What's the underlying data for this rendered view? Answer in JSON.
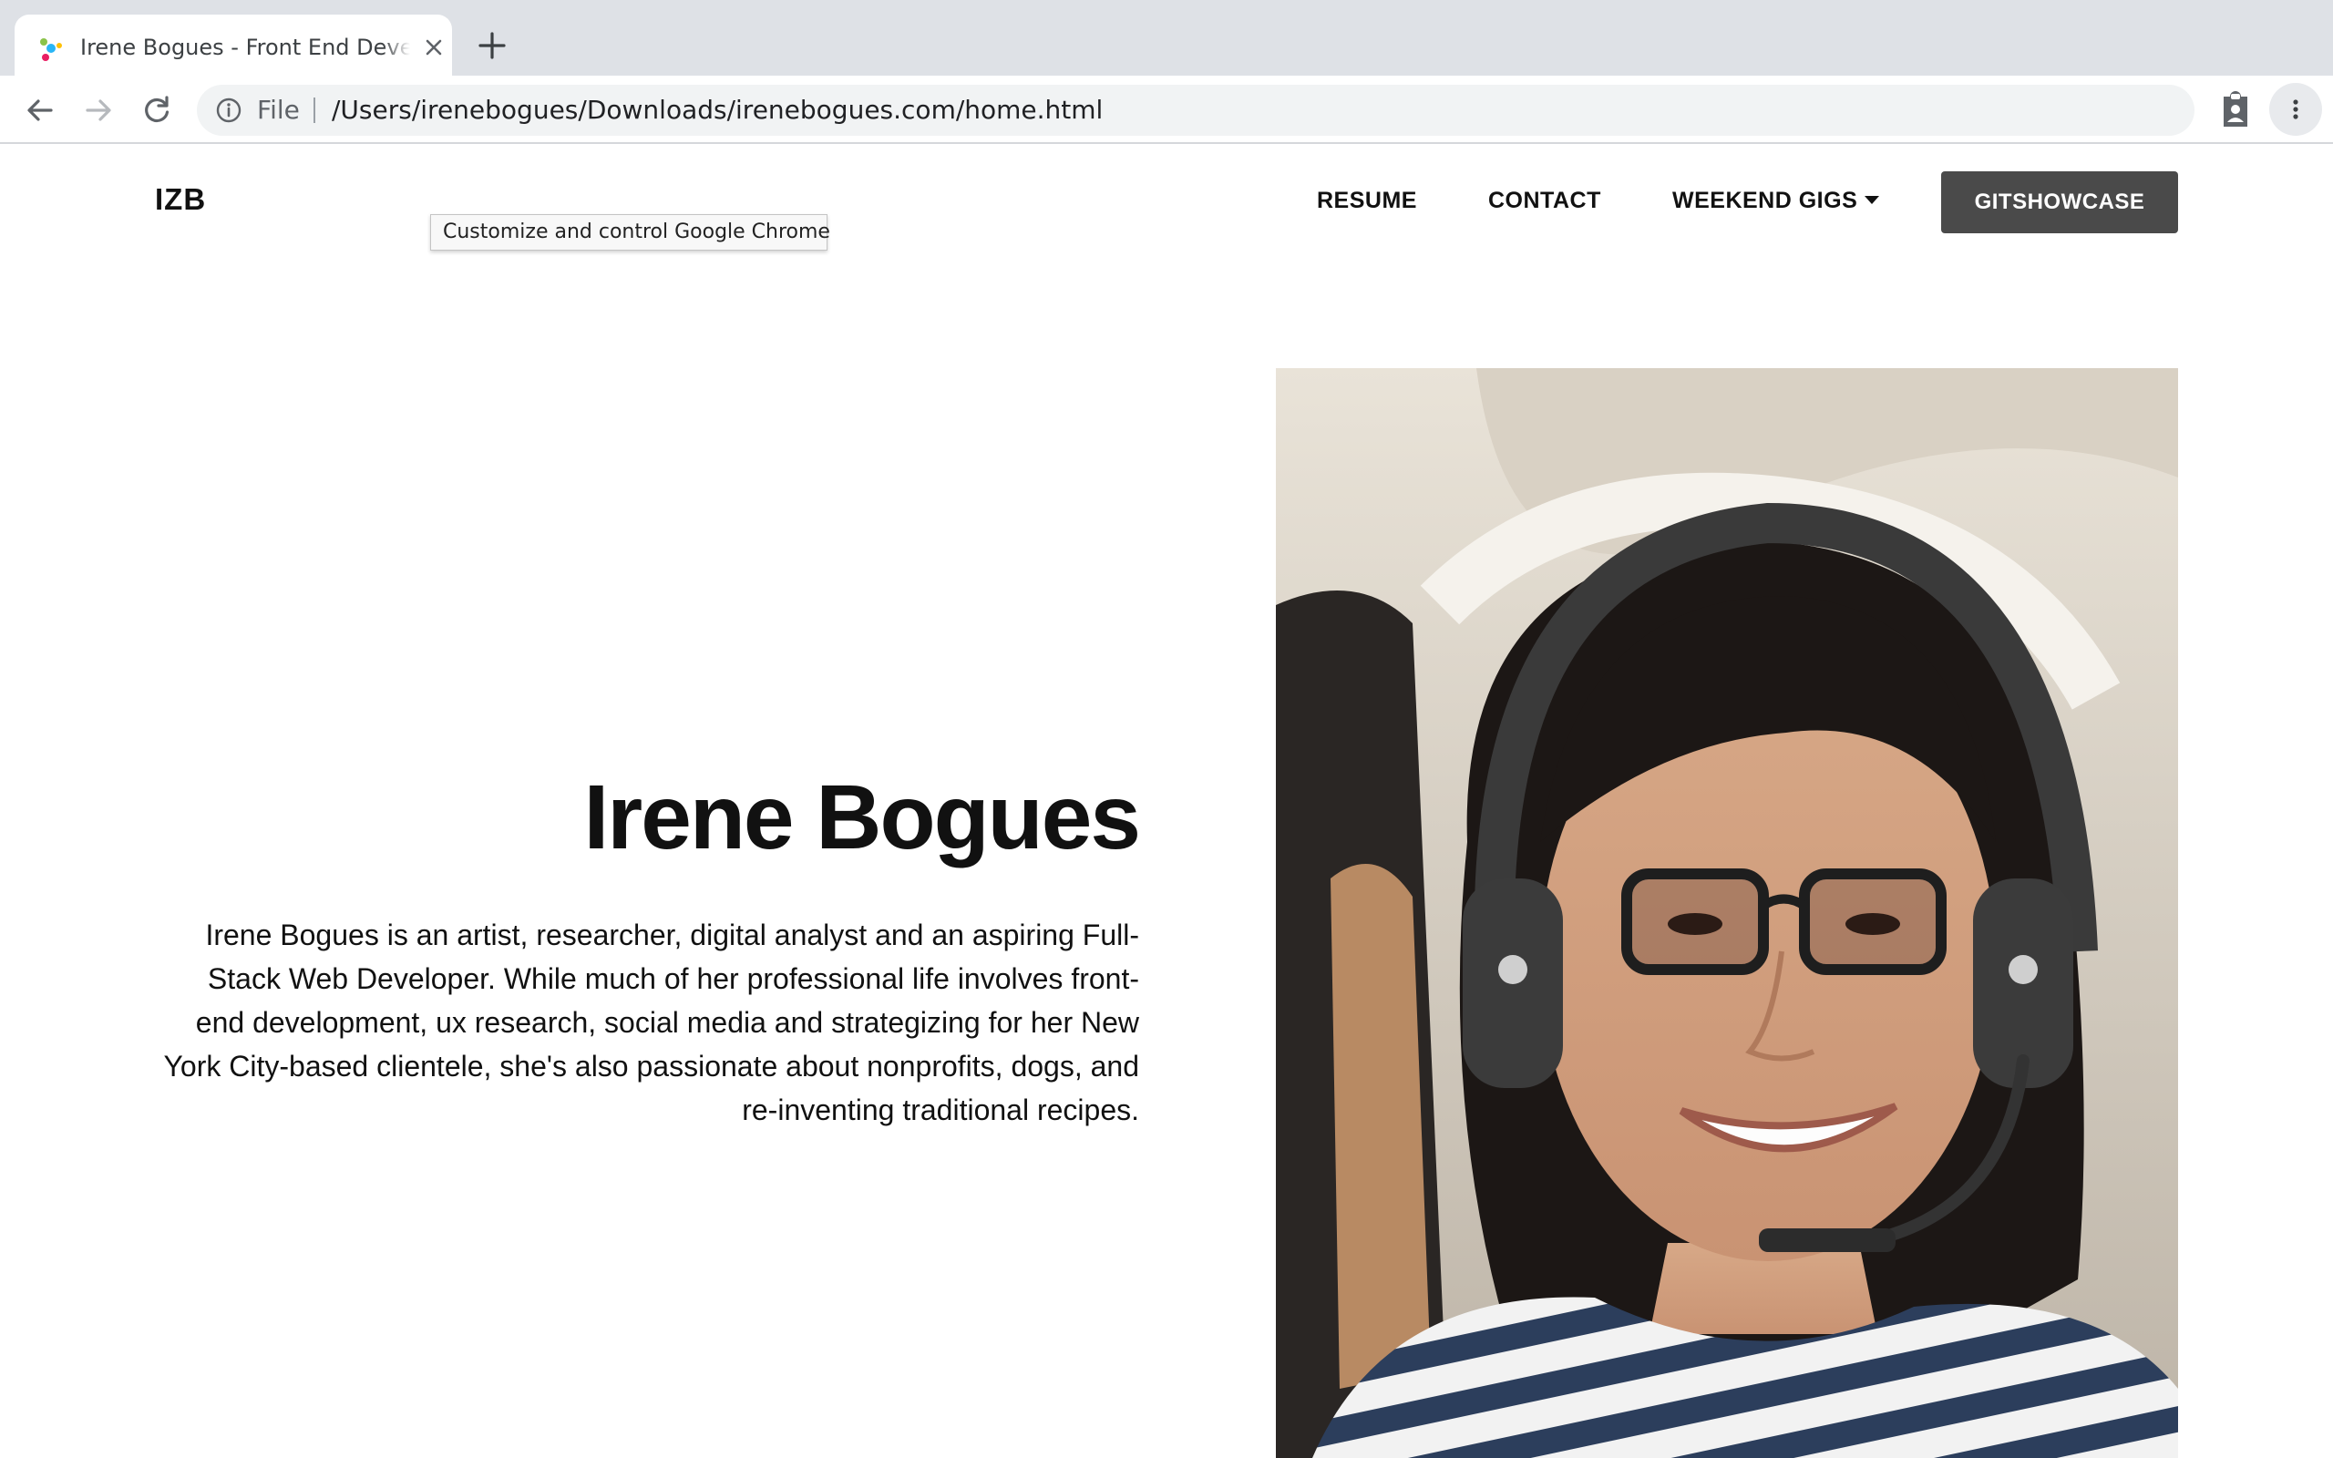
{
  "browser": {
    "tab_title": "Irene Bogues - Front End Developer",
    "url_scheme": "File",
    "url": "/Users/irenebogues/Downloads/irenebogues.com/home.html",
    "tooltip": "Customize and control Google Chrome"
  },
  "site": {
    "brand": "IZB",
    "nav": {
      "resume": "RESUME",
      "contact": "CONTACT",
      "weekend_gigs": "WEEKEND GIGS",
      "gitshowcase": "GITSHOWCASE"
    },
    "hero": {
      "name": "Irene Bogues",
      "bio": "Irene Bogues is an artist, researcher, digital analyst and an aspiring Full-Stack Web Developer. While much of her professional life involves front-end development, ux research, social media and strategizing for her New York City-based clientele, she's also passionate about nonprofits, dogs, and re-inventing traditional recipes."
    }
  },
  "colors": {
    "tabstrip": "#dee1e6",
    "omnibox": "#f1f3f4",
    "button_dark": "#4a4a4a"
  },
  "icons": {
    "favicon": "colorful-dots-favicon",
    "close": "close-icon",
    "new_tab": "plus-icon",
    "back": "back-arrow-icon",
    "forward": "forward-arrow-icon",
    "reload": "reload-icon",
    "info": "info-icon",
    "extension": "clipboard-person-icon",
    "menu": "kebab-menu-icon"
  }
}
